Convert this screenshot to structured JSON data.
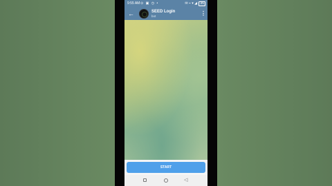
{
  "status_bar": {
    "time": "9:55 AM",
    "left_icons": "⊙ ▣ ◷ •",
    "right_icons": "✉ ⌁ ▾ ◢",
    "battery": "36"
  },
  "app_bar": {
    "back_icon": "←",
    "title": "SEED Login",
    "status": "bot",
    "menu_icon": "⋮"
  },
  "bottom_panel": {
    "start_label": "START"
  },
  "nav_bar": {
    "back_icon": "◁"
  },
  "colors": {
    "header": "#5b83a6",
    "start_button": "#4fa0ea",
    "backdrop": "#5f7a59"
  }
}
